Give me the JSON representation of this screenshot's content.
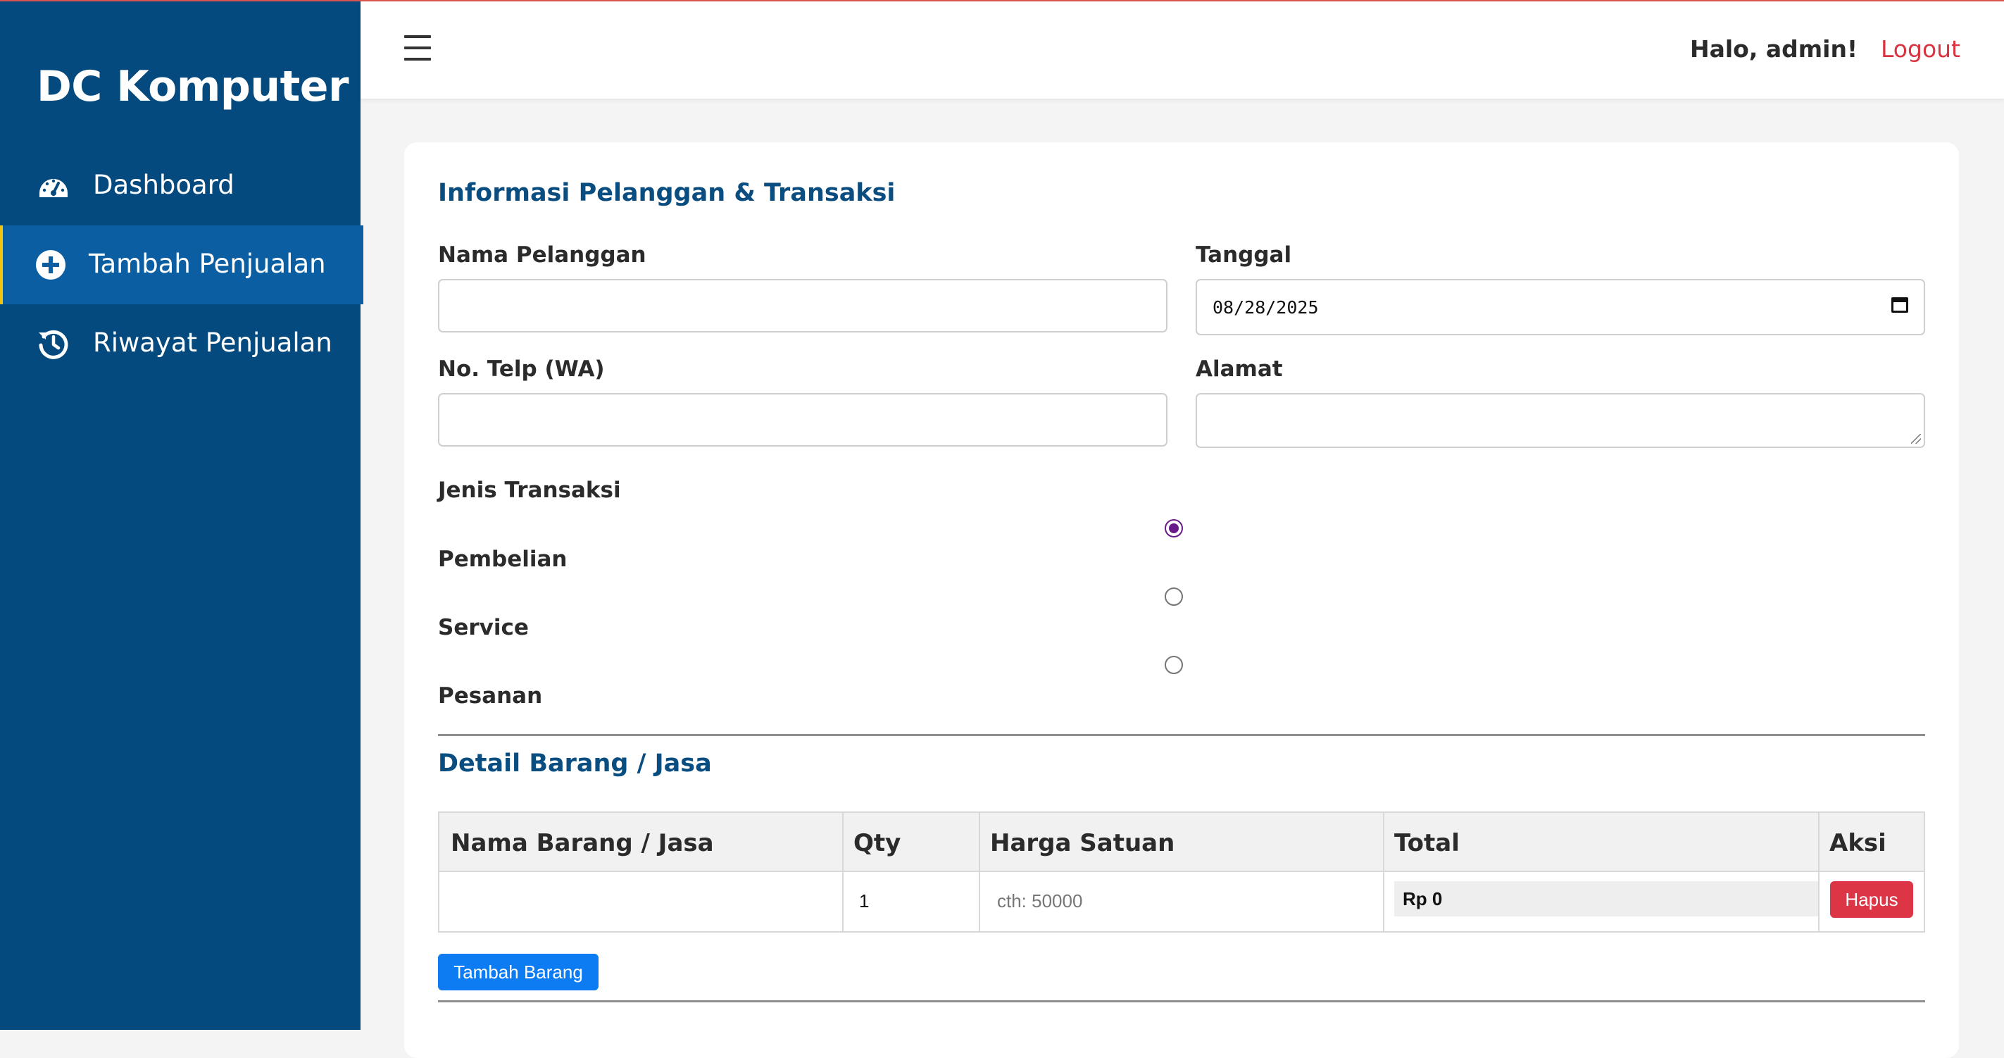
{
  "sidebar": {
    "brand": "DC Komputer",
    "items": [
      {
        "label": "Dashboard",
        "icon": "tachometer-icon",
        "active": false
      },
      {
        "label": "Tambah Penjualan",
        "icon": "plus-circle-icon",
        "active": true
      },
      {
        "label": "Riwayat Penjualan",
        "icon": "history-icon",
        "active": false
      }
    ]
  },
  "header": {
    "menu_icon": "hamburger-icon",
    "greeting": "Halo, admin!",
    "logout_label": "Logout"
  },
  "form": {
    "section_title": "Informasi Pelanggan & Transaksi",
    "nama_label": "Nama Pelanggan",
    "nama_value": "",
    "tanggal_label": "Tanggal",
    "tanggal_value": "08/28/2025",
    "telp_label": "No. Telp (WA)",
    "telp_value": "",
    "alamat_label": "Alamat",
    "alamat_value": "",
    "jenis_label": "Jenis Transaksi",
    "jenis_options": [
      {
        "label": "Pembelian",
        "checked": true
      },
      {
        "label": "Service",
        "checked": false
      },
      {
        "label": "Pesanan",
        "checked": false
      }
    ]
  },
  "detail": {
    "section_title": "Detail Barang / Jasa",
    "columns": [
      "Nama Barang / Jasa",
      "Qty",
      "Harga Satuan",
      "Total",
      "Aksi"
    ],
    "rows": [
      {
        "nama": "",
        "qty": "1",
        "harga_placeholder": "cth: 50000",
        "total": "Rp 0",
        "aksi_label": "Hapus"
      }
    ],
    "add_button_label": "Tambah Barang"
  },
  "colors": {
    "sidebar_bg": "#054a7e",
    "sidebar_active_bg": "#0a5ea1",
    "heading_blue": "#0a4d80",
    "logout_red": "#d9333f",
    "danger": "#dc3545",
    "primary": "#0d7bf2",
    "radio_checked": "#6a1b8a"
  }
}
